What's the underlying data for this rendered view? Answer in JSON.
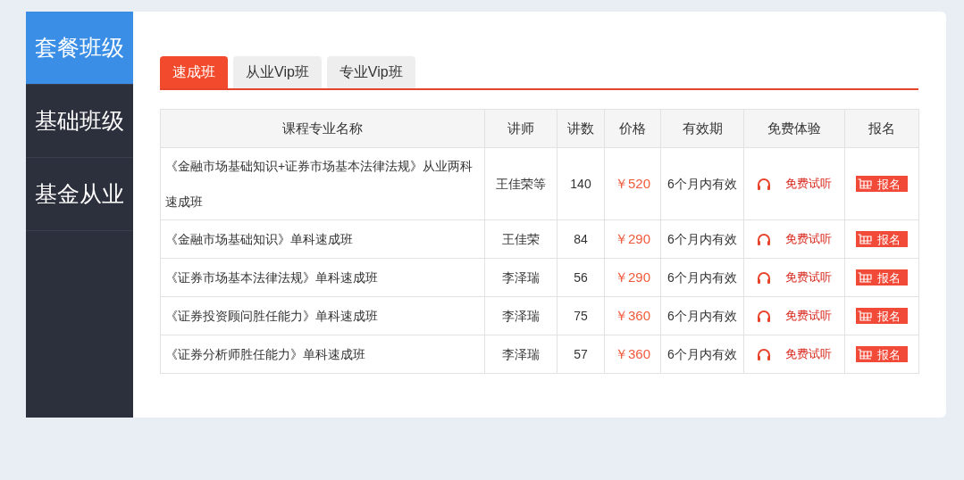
{
  "sidebar": {
    "items": [
      {
        "label": "套餐班级",
        "selected": true
      },
      {
        "label": "基础班级",
        "selected": false
      },
      {
        "label": "基金从业",
        "selected": false
      }
    ]
  },
  "tabs": [
    {
      "label": "速成班",
      "selected": true
    },
    {
      "label": "从业Vip班",
      "selected": false
    },
    {
      "label": "专业Vip班",
      "selected": false
    }
  ],
  "table": {
    "columns": [
      "课程专业名称",
      "讲师",
      "讲数",
      "价格",
      "有效期",
      "免费体验",
      "报名"
    ],
    "rows": [
      {
        "name": "《金融市场基础知识+证券市场基本法律法规》从业两科速成班",
        "teacher": "王佳荣等",
        "lessons": "140",
        "price": "￥520",
        "validity": "6个月内有效",
        "trial": "免费试听",
        "signup": "报名"
      },
      {
        "name": "《金融市场基础知识》单科速成班",
        "teacher": "王佳荣",
        "lessons": "84",
        "price": "￥290",
        "validity": "6个月内有效",
        "trial": "免费试听",
        "signup": "报名"
      },
      {
        "name": "《证券市场基本法律法规》单科速成班",
        "teacher": "李泽瑞",
        "lessons": "56",
        "price": "￥290",
        "validity": "6个月内有效",
        "trial": "免费试听",
        "signup": "报名"
      },
      {
        "name": "《证券投资顾问胜任能力》单科速成班",
        "teacher": "李泽瑞",
        "lessons": "75",
        "price": "￥360",
        "validity": "6个月内有效",
        "trial": "免费试听",
        "signup": "报名"
      },
      {
        "name": "《证券分析师胜任能力》单科速成班",
        "teacher": "李泽瑞",
        "lessons": "57",
        "price": "￥360",
        "validity": "6个月内有效",
        "trial": "免费试听",
        "signup": "报名"
      }
    ]
  }
}
